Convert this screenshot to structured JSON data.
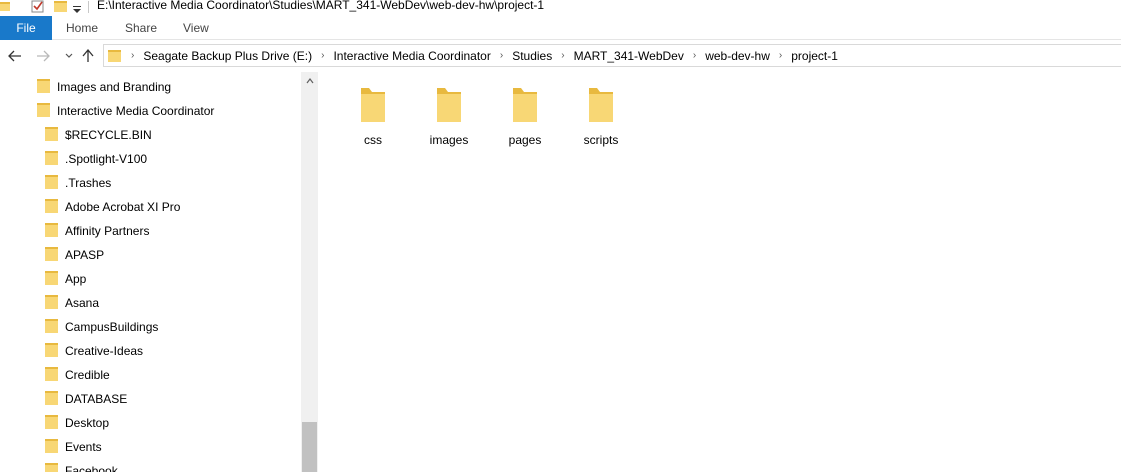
{
  "titlebar": {
    "path": "E:\\Interactive Media Coordinator\\Studies\\MART_341-WebDev\\web-dev-hw\\project-1",
    "quick_access_icons": [
      "folder-icon",
      "checkmark-icon",
      "folder-icon",
      "dropdown-arrow-icon"
    ]
  },
  "ribbon": {
    "tabs": [
      "File",
      "Home",
      "Share",
      "View"
    ],
    "file_color": "#1979ca"
  },
  "nav": {
    "back_icon": "back-arrow-icon",
    "forward_icon": "forward-arrow-icon",
    "recent_icon": "chevron-down-icon",
    "up_icon": "up-arrow-icon"
  },
  "breadcrumb": {
    "items": [
      "Seagate Backup Plus Drive (E:)",
      "Interactive Media Coordinator",
      "Studies",
      "MART_341-WebDev",
      "web-dev-hw",
      "project-1"
    ]
  },
  "sidebar": {
    "items": [
      "Images and Branding",
      "Interactive Media Coordinator",
      "$RECYCLE.BIN",
      ".Spotlight-V100",
      ".Trashes",
      "Adobe Acrobat XI Pro",
      "Affinity Partners",
      "APASP",
      "App",
      "Asana",
      "CampusBuildings",
      "Creative-Ideas",
      "Credible",
      "DATABASE",
      "Desktop",
      "Events",
      "Facebook"
    ]
  },
  "content": {
    "folders": [
      "css",
      "images",
      "pages",
      "scripts"
    ]
  },
  "colors": {
    "folder_fill": "#f8d775",
    "folder_back": "#e8b93f",
    "selection_blue": "#1979ca"
  }
}
